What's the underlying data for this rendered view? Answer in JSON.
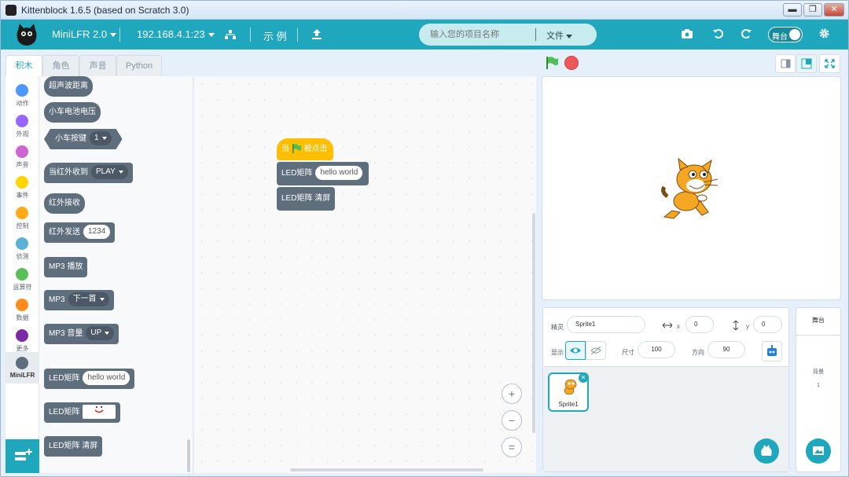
{
  "window": {
    "title": "Kittenblock 1.6.5 (based on Scratch 3.0)",
    "buttons": [
      "▬",
      "❐",
      "✕"
    ]
  },
  "menubar": {
    "device": "MiniLFR 2.0",
    "connection": "192.168.4.1:23",
    "examples": "示 例",
    "project_placeholder": "输入您的项目名称",
    "file_menu": "文件",
    "stage_toggle": "舞台"
  },
  "tabs": [
    "积木",
    "角色",
    "声音",
    "Python"
  ],
  "categories": [
    {
      "label": "动作",
      "color": "#4c97ff"
    },
    {
      "label": "外观",
      "color": "#9966ff"
    },
    {
      "label": "声音",
      "color": "#cf63cf"
    },
    {
      "label": "事件",
      "color": "#ffd500"
    },
    {
      "label": "控制",
      "color": "#ffab19"
    },
    {
      "label": "侦测",
      "color": "#5cb1d6"
    },
    {
      "label": "运算符",
      "color": "#59c059"
    },
    {
      "label": "数据",
      "color": "#ff8c1a"
    },
    {
      "label": "更多",
      "color": "#7a2aa6"
    },
    {
      "label": "MiniLFR",
      "color": "#5e6e7c"
    }
  ],
  "palette": {
    "ultrasonic": "超声波距离",
    "battery": "小车电池电压",
    "car_button": "小车按键",
    "car_button_value": "1",
    "ir_receive_when": "当红外收到",
    "ir_receive_value": "PLAY",
    "ir_receive": "红外接收",
    "ir_send": "红外发送",
    "ir_send_value": "1234",
    "mp3_play": "MP3 播放",
    "mp3": "MP3",
    "mp3_next": "下一首",
    "mp3_volume": "MP3 音量",
    "mp3_volume_value": "UP",
    "led_matrix": "LED矩阵",
    "led_matrix_text": "hello world",
    "led_matrix_face": "LED矩阵",
    "led_matrix_clear": "LED矩阵 清屏"
  },
  "script": {
    "hat_when": "当",
    "hat_clicked": "被点击",
    "led": "LED矩阵",
    "led_text": "hello world",
    "clear": "LED矩阵 清屏"
  },
  "zoom": {
    "in": "+",
    "out": "−",
    "reset": "="
  },
  "sprite_info": {
    "sprite_label": "精灵",
    "sprite_name": "Sprite1",
    "x_label": "x",
    "x_value": "0",
    "y_label": "y",
    "y_value": "0",
    "show_label": "显示",
    "size_label": "尺寸",
    "size_value": "100",
    "direction_label": "方向",
    "direction_value": "90"
  },
  "sprite_list": [
    {
      "name": "Sprite1"
    }
  ],
  "stage_panel": {
    "title": "舞台",
    "backdrop_label": "背景",
    "backdrop_count": "1"
  }
}
